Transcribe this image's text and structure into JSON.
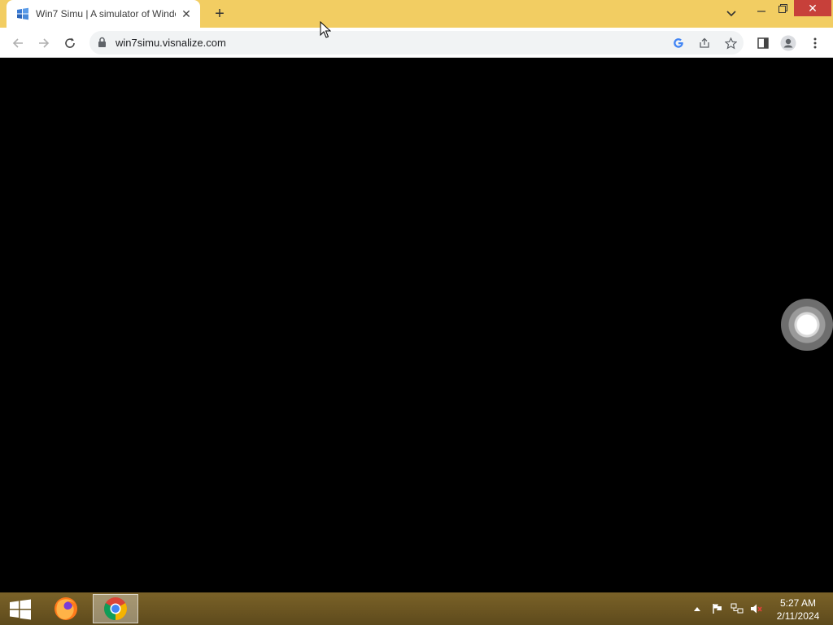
{
  "browser": {
    "tab": {
      "title": "Win7 Simu | A simulator of Windows 7",
      "favicon": "windows-flag-icon"
    },
    "new_tab_label": "+",
    "window_controls": {
      "tab_search": "chevron-down-icon",
      "minimize": "minimize-icon",
      "restore": "restore-icon",
      "close": "close-icon"
    },
    "toolbar": {
      "back": "back-arrow-icon",
      "forward": "forward-arrow-icon",
      "reload": "reload-icon",
      "url": "win7simu.visnalize.com",
      "omnibox_icons": [
        "google-icon",
        "share-icon",
        "star-icon"
      ],
      "side_panel": "side-panel-icon",
      "profile": "profile-icon",
      "menu": "more-menu-icon"
    }
  },
  "page": {
    "background": "#000000"
  },
  "taskbar": {
    "start": "windows-start-icon",
    "apps": [
      {
        "name": "Firefox",
        "icon": "firefox-icon",
        "active": false
      },
      {
        "name": "Google Chrome",
        "icon": "chrome-icon",
        "active": true
      }
    ],
    "tray": [
      "show-hidden-icons-icon",
      "action-center-flag-icon",
      "network-icon",
      "volume-muted-icon"
    ],
    "clock": {
      "time": "5:27 AM",
      "date": "2/11/2024"
    }
  },
  "colors": {
    "titlebar": "#f2cd62",
    "close_button": "#c7403a",
    "taskbar": "#6b5522"
  }
}
